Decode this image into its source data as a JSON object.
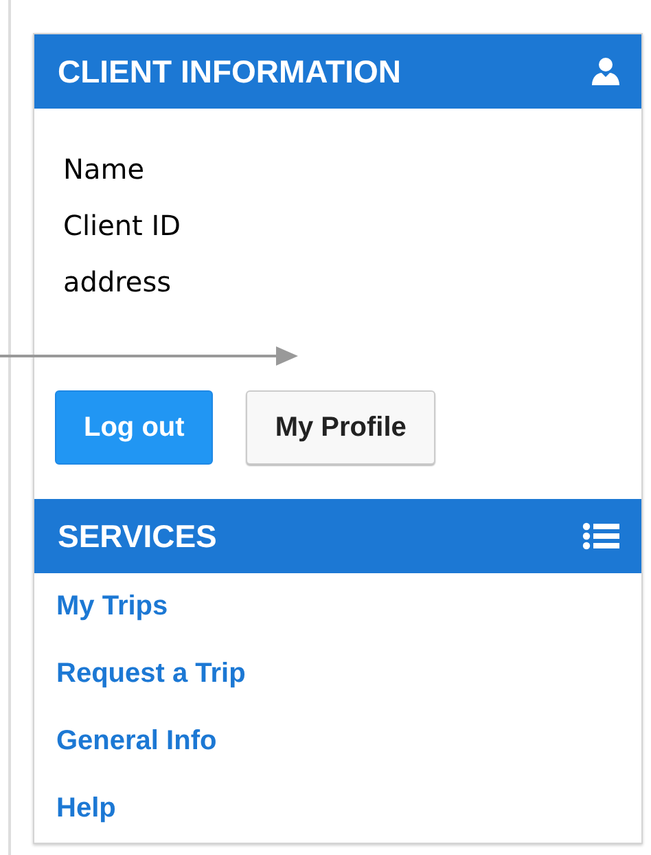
{
  "client_information": {
    "title": "CLIENT INFORMATION",
    "fields": [
      "Name",
      "Client ID",
      "address"
    ]
  },
  "buttons": [
    {
      "label": "Log out",
      "kind": "primary"
    },
    {
      "label": "My Profile",
      "kind": "default"
    }
  ],
  "services": {
    "title": "SERVICES",
    "items": [
      "My Trips",
      "Request a Trip",
      "General Info",
      "Help"
    ]
  }
}
